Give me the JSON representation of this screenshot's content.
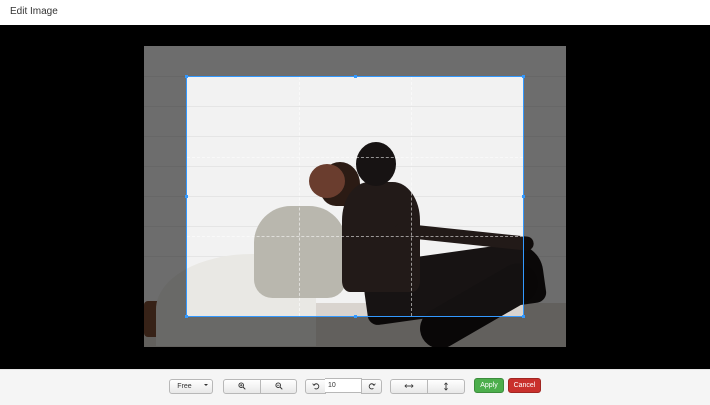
{
  "window": {
    "title": "Edit Image"
  },
  "toolbar": {
    "aspect_ratio": "Free",
    "angle_value": "10",
    "apply_label": "Apply",
    "cancel_label": "Cancel"
  },
  "colors": {
    "selection": "#3399ff",
    "apply": "#4cae4c",
    "cancel": "#c9302c",
    "stage": "#000000",
    "toolbar": "#f5f5f5"
  },
  "icons": [
    "chevron-down-icon",
    "zoom-in-icon",
    "zoom-out-icon",
    "rotate-left-icon",
    "rotate-right-icon",
    "flip-horizontal-icon",
    "flip-vertical-icon"
  ]
}
